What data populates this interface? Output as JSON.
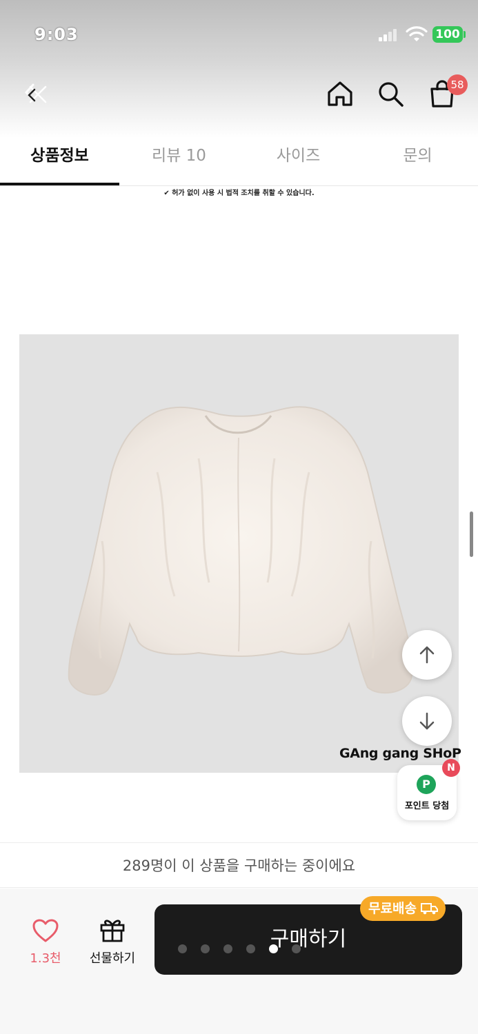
{
  "status": {
    "time": "9:03",
    "battery": "100"
  },
  "header": {
    "cart_count": "58"
  },
  "tabs": [
    {
      "label": "상품정보",
      "active": true
    },
    {
      "label": "리뷰 10",
      "active": false
    },
    {
      "label": "사이즈",
      "active": false
    },
    {
      "label": "문의",
      "active": false
    }
  ],
  "notice": "✔ 허가 없이 사용 시 법적 조치를 취할 수 있습니다.",
  "product": {
    "shop_watermark": "GAng gang SHoP"
  },
  "floating": {
    "point_badge": "N",
    "point_icon": "P",
    "point_label": "포인트 당첨"
  },
  "buying_text": "289명이 이 상품을 구매하는 중이에요",
  "bottom": {
    "like_count": "1.3천",
    "gift_label": "선물하기",
    "buy_label": "구매하기",
    "free_shipping": "무료배송"
  },
  "carousel": {
    "count": 6,
    "active_index": 4
  },
  "colors": {
    "accent": "#f7a928",
    "like": "#e85c6a",
    "buy_bg": "#1b1b1b",
    "badge": "#e85c5c"
  }
}
